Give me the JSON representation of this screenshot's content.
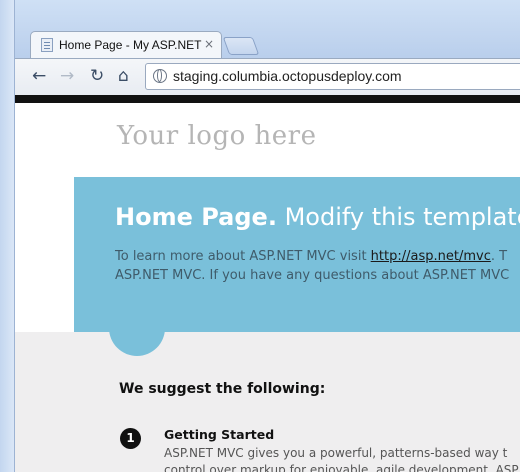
{
  "browser": {
    "tab_title": "Home Page - My ASP.NET",
    "tab_close": "×",
    "url": "staging.columbia.octopusdeploy.com",
    "nav_icons": [
      "back-arrow-icon",
      "forward-arrow-icon",
      "reload-icon",
      "home-icon",
      "globe-icon"
    ]
  },
  "page": {
    "logo_text": "Your logo here",
    "featured": {
      "headline_bold": "Home Page.",
      "headline_rest": " Modify this template to",
      "intro_line1_prefix": "To learn more about ASP.NET MVC visit ",
      "intro_link": "http://asp.net/mvc",
      "intro_line1_suffix": ". T",
      "intro_line2": "ASP.NET MVC. If you have any questions about ASP.NET MVC"
    },
    "suggest_heading": "We suggest the following:",
    "steps": [
      {
        "number": "1",
        "title": "Getting Started",
        "line1": "ASP.NET MVC gives you a powerful, patterns-based way t",
        "line2": "control over markup for enjoyable, agile development. ASP"
      }
    ]
  },
  "colors": {
    "featured_bg": "#7ac0da",
    "top_bar": "#111111",
    "gray_band": "#efeeef"
  }
}
